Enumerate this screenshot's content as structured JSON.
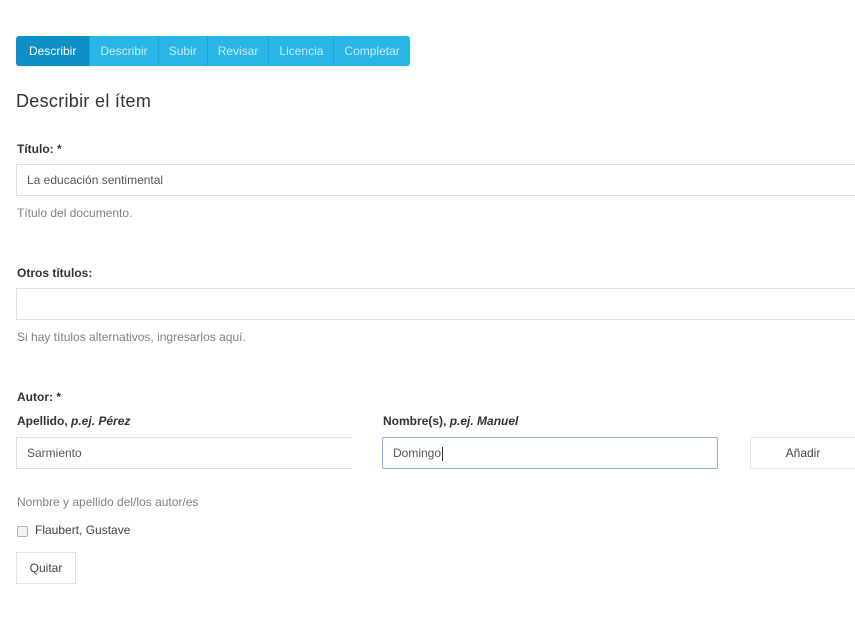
{
  "steps": [
    "Describir",
    "Describir",
    "Subir",
    "Revisar",
    "Licencia",
    "Completar"
  ],
  "page_title": "Describir el ítem",
  "title_field": {
    "label": "Título: *",
    "value": "La educación sentimental",
    "hint": "Título del documento."
  },
  "other_titles": {
    "label": "Otros títulos:",
    "value": "",
    "hint": "Si hay títulos alternativos, ingresarlos aquí."
  },
  "author": {
    "label": "Autor: *",
    "lastname_label": "Apellido,",
    "lastname_example": "p.ej. Pérez",
    "lastname_value": "Sarmiento",
    "firstname_label": "Nombre(s),",
    "firstname_example": "p.ej. Manuel",
    "firstname_value": "Domingo",
    "add_button": "Añadir",
    "hint": "Nombre y apellido del/los autor/es",
    "entries": [
      "Flaubert, Gustave"
    ],
    "remove_button": "Quitar"
  },
  "colors": {
    "step_active": "#0f8fc7",
    "step": "#29b5e6",
    "focus_border": "#8fb3d9"
  }
}
